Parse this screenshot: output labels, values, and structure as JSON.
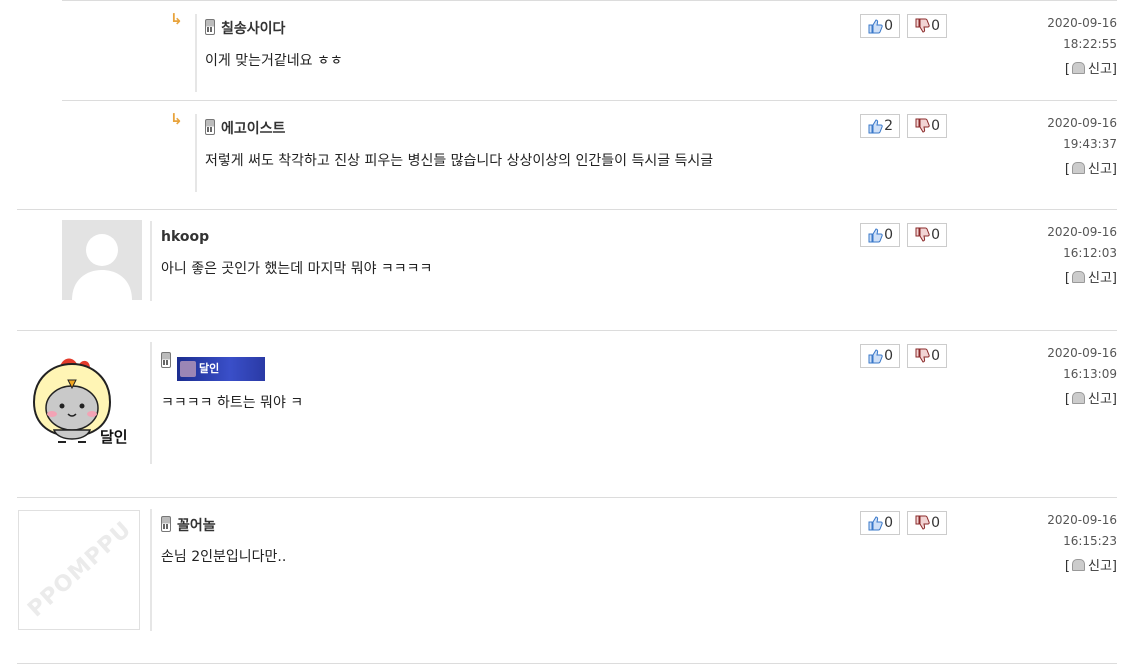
{
  "comments": [
    {
      "nick": "칠송사이다",
      "text": "이게 맞는거같네요 ㅎㅎ",
      "up": "0",
      "down": "0",
      "date": "2020-09-16",
      "time": "18:22:55",
      "report": "신고"
    },
    {
      "nick": "에고이스트",
      "text": "저렇게 써도 착각하고 진상 피우는 병신들 많습니다 상상이상의 인간들이 득시글 득시글",
      "up": "2",
      "down": "0",
      "date": "2020-09-16",
      "time": "19:43:37",
      "report": "신고"
    },
    {
      "nick": "hkoop",
      "text": "아니 좋은 곳인가 했는데 마지막 뭐야 ㅋㅋㅋㅋ",
      "up": "0",
      "down": "0",
      "date": "2020-09-16",
      "time": "16:12:03",
      "report": "신고"
    },
    {
      "nick": "달인",
      "text": "ㅋㅋㅋㅋ 하트는 뭐야 ㅋ",
      "up": "0",
      "down": "0",
      "date": "2020-09-16",
      "time": "16:13:09",
      "report": "신고",
      "avatar_caption": "달인"
    },
    {
      "nick": "꼴어놀",
      "text": "손님 2인분입니다만..",
      "up": "0",
      "down": "0",
      "date": "2020-09-16",
      "time": "16:15:23",
      "report": "신고",
      "avatar_watermark": "PPOMPPU"
    }
  ],
  "icons": {
    "reply": "reply-arrow-icon",
    "phone": "mobile-phone-icon",
    "like": "thumbs-up-icon",
    "dislike": "thumbs-down-icon",
    "report": "report-bell-icon"
  },
  "colors": {
    "reply_arrow": "#e8a33c",
    "like": "#3a78c9",
    "dislike": "#8a2a2a"
  }
}
